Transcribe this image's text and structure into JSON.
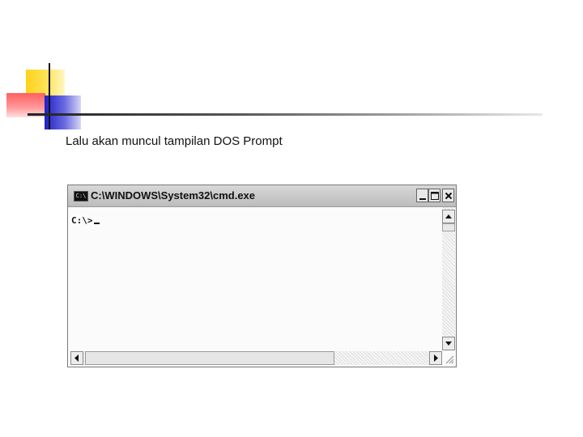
{
  "slide": {
    "caption": "Lalu akan muncul tampilan DOS Prompt"
  },
  "window": {
    "title": "C:\\WINDOWS\\System32\\cmd.exe",
    "app_icon_text": "C:\\",
    "prompt": "C:\\>",
    "icons": {
      "app": "console-icon",
      "minimize": "minimize-icon",
      "maximize": "maximize-icon",
      "close": "close-icon",
      "scroll_up": "arrow-up-icon",
      "scroll_down": "arrow-down-icon",
      "scroll_left": "arrow-left-icon",
      "scroll_right": "arrow-right-icon",
      "resize": "resize-grip-icon"
    }
  },
  "colors": {
    "console_bg": "#fbfbfb",
    "titlebar": "#c8c8c8",
    "deco_yellow": "#ffd21a",
    "deco_red": "#ff6060",
    "deco_blue": "#2020c8"
  }
}
